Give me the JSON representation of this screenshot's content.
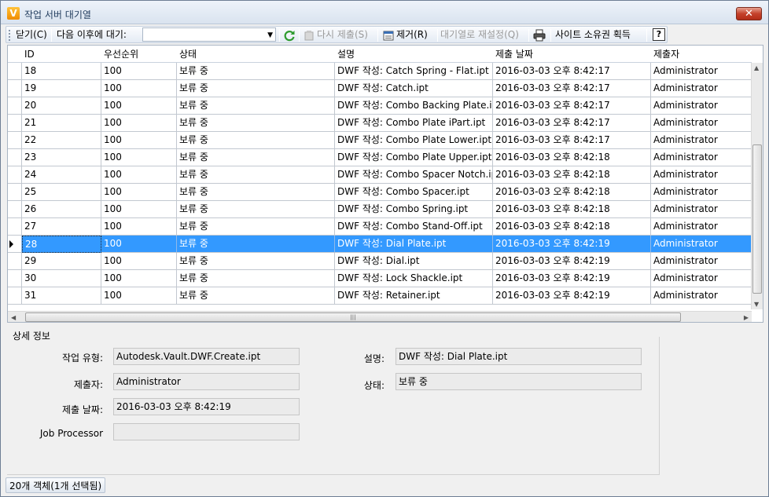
{
  "window": {
    "title": "작업 서버 대기열",
    "close_glyph": "✕",
    "app_icon_letter": "V"
  },
  "toolbar": {
    "close_label": "닫기(C)",
    "wait_label": "다음 이후에 대기:",
    "wait_value": "",
    "resubmit_label": "다시 제출(S)",
    "remove_label": "제거(R)",
    "reset_label": "대기열로 재설정(Q)",
    "take_ownership_label": "사이트 소유권 획득",
    "help_label": "?"
  },
  "grid": {
    "columns": [
      "ID",
      "우선순위",
      "상태",
      "설명",
      "제출 날짜",
      "제출자"
    ],
    "rows": [
      {
        "id": "18",
        "priority": "100",
        "status": "보류 중",
        "desc": "DWF 작성: Catch Spring - Flat.ipt",
        "date": "2016-03-03 오후 8:42:17",
        "by": "Administrator"
      },
      {
        "id": "19",
        "priority": "100",
        "status": "보류 중",
        "desc": "DWF 작성: Catch.ipt",
        "date": "2016-03-03 오후 8:42:17",
        "by": "Administrator"
      },
      {
        "id": "20",
        "priority": "100",
        "status": "보류 중",
        "desc": "DWF 작성: Combo Backing Plate.ipt",
        "date": "2016-03-03 오후 8:42:17",
        "by": "Administrator"
      },
      {
        "id": "21",
        "priority": "100",
        "status": "보류 중",
        "desc": "DWF 작성: Combo Plate iPart.ipt",
        "date": "2016-03-03 오후 8:42:17",
        "by": "Administrator"
      },
      {
        "id": "22",
        "priority": "100",
        "status": "보류 중",
        "desc": "DWF 작성: Combo Plate Lower.ipt",
        "date": "2016-03-03 오후 8:42:17",
        "by": "Administrator"
      },
      {
        "id": "23",
        "priority": "100",
        "status": "보류 중",
        "desc": "DWF 작성: Combo Plate Upper.ipt",
        "date": "2016-03-03 오후 8:42:18",
        "by": "Administrator"
      },
      {
        "id": "24",
        "priority": "100",
        "status": "보류 중",
        "desc": "DWF 작성: Combo Spacer Notch.ipt",
        "date": "2016-03-03 오후 8:42:18",
        "by": "Administrator"
      },
      {
        "id": "25",
        "priority": "100",
        "status": "보류 중",
        "desc": "DWF 작성: Combo Spacer.ipt",
        "date": "2016-03-03 오후 8:42:18",
        "by": "Administrator"
      },
      {
        "id": "26",
        "priority": "100",
        "status": "보류 중",
        "desc": "DWF 작성: Combo Spring.ipt",
        "date": "2016-03-03 오후 8:42:18",
        "by": "Administrator"
      },
      {
        "id": "27",
        "priority": "100",
        "status": "보류 중",
        "desc": "DWF 작성: Combo Stand-Off.ipt",
        "date": "2016-03-03 오후 8:42:18",
        "by": "Administrator"
      },
      {
        "id": "28",
        "priority": "100",
        "status": "보류 중",
        "desc": "DWF 작성: Dial Plate.ipt",
        "date": "2016-03-03 오후 8:42:19",
        "by": "Administrator",
        "selected": true
      },
      {
        "id": "29",
        "priority": "100",
        "status": "보류 중",
        "desc": "DWF 작성: Dial.ipt",
        "date": "2016-03-03 오후 8:42:19",
        "by": "Administrator"
      },
      {
        "id": "30",
        "priority": "100",
        "status": "보류 중",
        "desc": "DWF 작성: Lock Shackle.ipt",
        "date": "2016-03-03 오후 8:42:19",
        "by": "Administrator"
      },
      {
        "id": "31",
        "priority": "100",
        "status": "보류 중",
        "desc": "DWF 작성: Retainer.ipt",
        "date": "2016-03-03 오후 8:42:19",
        "by": "Administrator"
      }
    ]
  },
  "details": {
    "section_label": "상세 정보",
    "job_type_label": "작업 유형:",
    "job_type_value": "Autodesk.Vault.DWF.Create.ipt",
    "submitter_label": "제출자:",
    "submitter_value": "Administrator",
    "date_label": "제출 날짜:",
    "date_value": "2016-03-03 오후 8:42:19",
    "processor_label": "Job Processor",
    "processor_value": "",
    "desc_label": "설명:",
    "desc_value": "DWF 작성: Dial Plate.ipt",
    "status_label": "상태:",
    "status_value": "보류 중"
  },
  "statusbar": {
    "text": "20개 객체(1개 선택됨)"
  },
  "colors": {
    "selection": "#3399ff",
    "grid_line": "#c2c8d0"
  },
  "icons": [
    "refresh-icon",
    "resubmit-icon",
    "remove-icon",
    "print-icon",
    "help-icon"
  ]
}
